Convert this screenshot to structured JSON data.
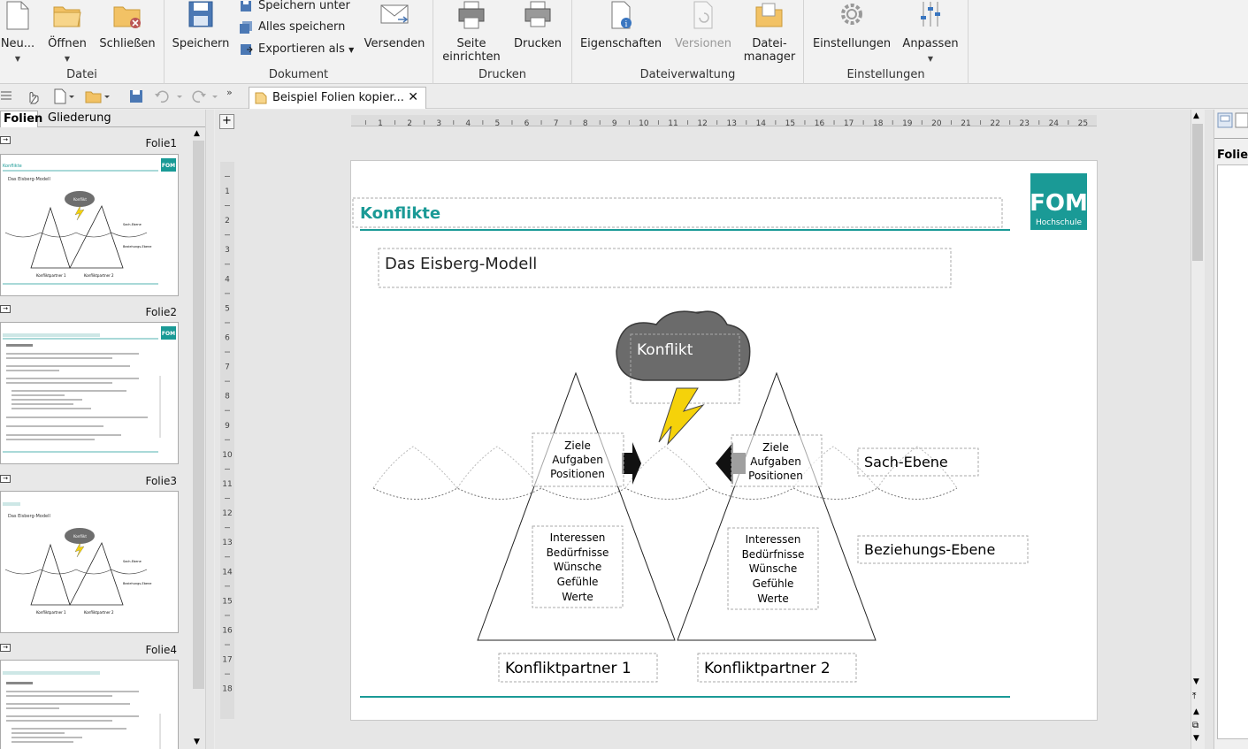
{
  "ribbon": {
    "file_group": {
      "label": "Datei",
      "new": "Neu...",
      "open": "Öffnen",
      "close": "Schließen"
    },
    "document_group": {
      "label": "Dokument",
      "save": "Speichern",
      "save_as": "Speichern unter",
      "save_all": "Alles speichern",
      "export_as": "Exportieren als",
      "send": "Versenden"
    },
    "print_group": {
      "label": "Drucken",
      "page_setup_1": "Seite",
      "page_setup_2": "einrichten",
      "print": "Drucken"
    },
    "file_mgmt_group": {
      "label": "Dateiverwaltung",
      "properties": "Eigenschaften",
      "versions": "Versionen",
      "file_manager_1": "Datei-",
      "file_manager_2": "manager"
    },
    "settings_group": {
      "label": "Einstellungen",
      "settings": "Einstellungen",
      "customize": "Anpassen"
    }
  },
  "doc_tab": {
    "title": "Beispiel Folien kopier...",
    "close": "✕"
  },
  "panel": {
    "tab_slides": "Folien",
    "tab_outline": "Gliederung",
    "slides": [
      {
        "label": "Folie1"
      },
      {
        "label": "Folie2"
      },
      {
        "label": "Folie3"
      },
      {
        "label": "Folie4"
      }
    ]
  },
  "ruler": {
    "h_ticks": [
      "1",
      "2",
      "3",
      "4",
      "5",
      "6",
      "7",
      "8",
      "9",
      "10",
      "11",
      "12",
      "13",
      "14",
      "15",
      "16",
      "17",
      "18",
      "19",
      "20",
      "21",
      "22",
      "23",
      "24",
      "25"
    ],
    "v_ticks": [
      "1",
      "2",
      "3",
      "4",
      "5",
      "6",
      "7",
      "8",
      "9",
      "10",
      "11",
      "12",
      "13",
      "14",
      "15",
      "16",
      "17",
      "18"
    ]
  },
  "slide": {
    "title": "Konflikte",
    "subtitle": "Das Eisberg-Modell",
    "logo_text": "FOM",
    "logo_sub": "Hochschule",
    "cloud_label": "Konflikt",
    "left_upper": [
      "Ziele",
      "Aufgaben",
      "Positionen"
    ],
    "right_upper": [
      "Ziele",
      "Aufgaben",
      "Positionen"
    ],
    "left_lower": [
      "Interessen",
      "Bedürfnisse",
      "Wünsche",
      "Gefühle",
      "Werte"
    ],
    "right_lower": [
      "Interessen",
      "Bedürfnisse",
      "Wünsche",
      "Gefühle",
      "Werte"
    ],
    "sach_ebene": "Sach-Ebene",
    "beziehungs_ebene": "Beziehungs-Ebene",
    "partner1": "Konfliktpartner 1",
    "partner2": "Konfliktpartner 2"
  },
  "sidebar": {
    "label": "Folien"
  },
  "colors": {
    "accent": "#1a9a96",
    "cloud": "#6e6e6e",
    "bolt": "#f5d20a"
  }
}
